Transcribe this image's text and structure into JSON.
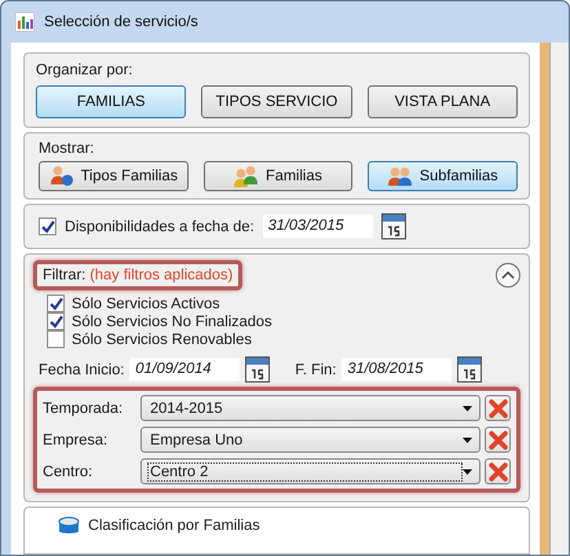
{
  "window": {
    "title": "Selección de servicio/s"
  },
  "organize": {
    "label": "Organizar por:",
    "options": [
      {
        "label": "FAMILIAS",
        "selected": true
      },
      {
        "label": "TIPOS SERVICIO",
        "selected": false
      },
      {
        "label": "VISTA PLANA",
        "selected": false
      }
    ]
  },
  "show": {
    "label": "Mostrar:",
    "options": [
      {
        "label": "Tipos Familias",
        "selected": false
      },
      {
        "label": "Familias",
        "selected": false
      },
      {
        "label": "Subfamilias",
        "selected": true
      }
    ]
  },
  "availability": {
    "label": "Disponibilidades a fecha de:",
    "checked": true,
    "date": "31/03/2015"
  },
  "filter": {
    "label": "Filtrar:",
    "note": "(hay filtros aplicados)",
    "expanded": true,
    "checks": [
      {
        "label": "Sólo Servicios Activos",
        "checked": true
      },
      {
        "label": "Sólo Servicios No Finalizados",
        "checked": true
      },
      {
        "label": "Sólo Servicios Renovables",
        "checked": false
      }
    ],
    "start": {
      "label": "Fecha Inicio:",
      "value": "01/09/2014"
    },
    "end": {
      "label": "F. Fin:",
      "value": "31/08/2015"
    },
    "selects": [
      {
        "label": "Temporada:",
        "value": "2014-2015",
        "focused": false
      },
      {
        "label": "Empresa:",
        "value": "Empresa Uno",
        "focused": false
      },
      {
        "label": "Centro:",
        "value": "Centro 2",
        "focused": true
      }
    ]
  },
  "tree": {
    "items": [
      {
        "label": "Clasificación por Familias"
      }
    ]
  }
}
